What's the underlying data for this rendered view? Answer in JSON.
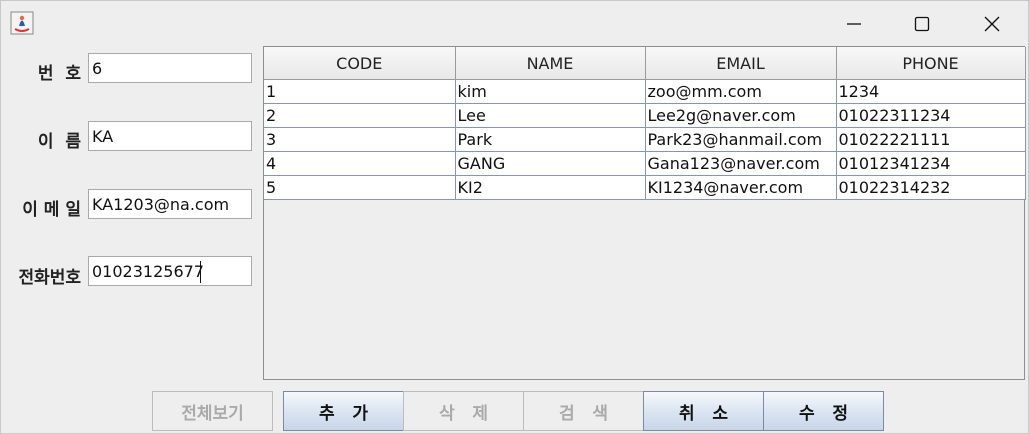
{
  "window": {
    "controls": {
      "minimize_icon": "minimize-icon",
      "maximize_icon": "maximize-icon",
      "close_icon": "close-icon"
    }
  },
  "form": {
    "number": {
      "label": "번  호",
      "value": "6"
    },
    "name": {
      "label": "이  름",
      "value": "KA"
    },
    "email": {
      "label": "이 메 일",
      "value": "KA1203@na.com"
    },
    "phone": {
      "label": "전화번호",
      "value": "01023125677"
    }
  },
  "table": {
    "columns": [
      "CODE",
      "NAME",
      "EMAIL",
      "PHONE"
    ],
    "rows": [
      [
        "1",
        "kim",
        "zoo@mm.com",
        "1234"
      ],
      [
        "2",
        "Lee",
        "Lee2g@naver.com",
        "01022311234"
      ],
      [
        "3",
        "Park",
        "Park23@hanmail.com",
        "01022221111"
      ],
      [
        "4",
        "GANG",
        "Gana123@naver.com",
        "01012341234"
      ],
      [
        "5",
        "KI2",
        "KI1234@naver.com",
        "01022314232"
      ]
    ]
  },
  "buttons": {
    "view_all": "전체보기",
    "add": "추   가",
    "delete": "삭   제",
    "search": "검   색",
    "cancel": "취   소",
    "edit": "수   정"
  }
}
